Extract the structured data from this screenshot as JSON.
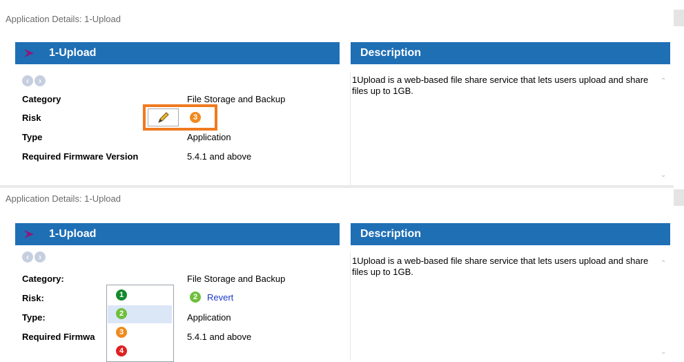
{
  "top": {
    "window_title": "Application Details: 1-Upload",
    "app_title": "1-Upload",
    "description_heading": "Description",
    "description_text": "1Upload is a web-based file share service that lets users upload and share files up to 1GB.",
    "labels": {
      "category": "Category",
      "risk": "Risk",
      "type": "Type",
      "firmware": "Required Firmware Version"
    },
    "values": {
      "category": "File Storage and Backup",
      "risk": "3",
      "type": "Application",
      "firmware": "5.4.1 and above"
    },
    "icons": {
      "back": "back-arrow-icon",
      "forward": "forward-arrow-icon",
      "edit": "pencil-icon"
    }
  },
  "bottom": {
    "window_title": "Application Details: 1-Upload",
    "app_title": "1-Upload",
    "description_heading": "Description",
    "description_text": "1Upload is a web-based file share service that lets users upload and share files up to 1GB.",
    "labels": {
      "category": "Category:",
      "risk": "Risk:",
      "type": "Type:",
      "firmware": "Required Firmwa"
    },
    "values": {
      "category": "File Storage and Backup",
      "risk": "2",
      "type": "Application",
      "firmware": "5.4.1 and above"
    },
    "revert_label": "Revert",
    "risk_dropdown": {
      "options": [
        "1",
        "2",
        "3",
        "4"
      ],
      "selected": "2"
    }
  },
  "colors": {
    "header": "#1f6fb5",
    "risk_1": "#128a2e",
    "risk_2": "#6fbf3c",
    "risk_3": "#f08a1e",
    "risk_4": "#e11f1f",
    "highlight": "#f07a20",
    "link": "#1b39c7"
  }
}
